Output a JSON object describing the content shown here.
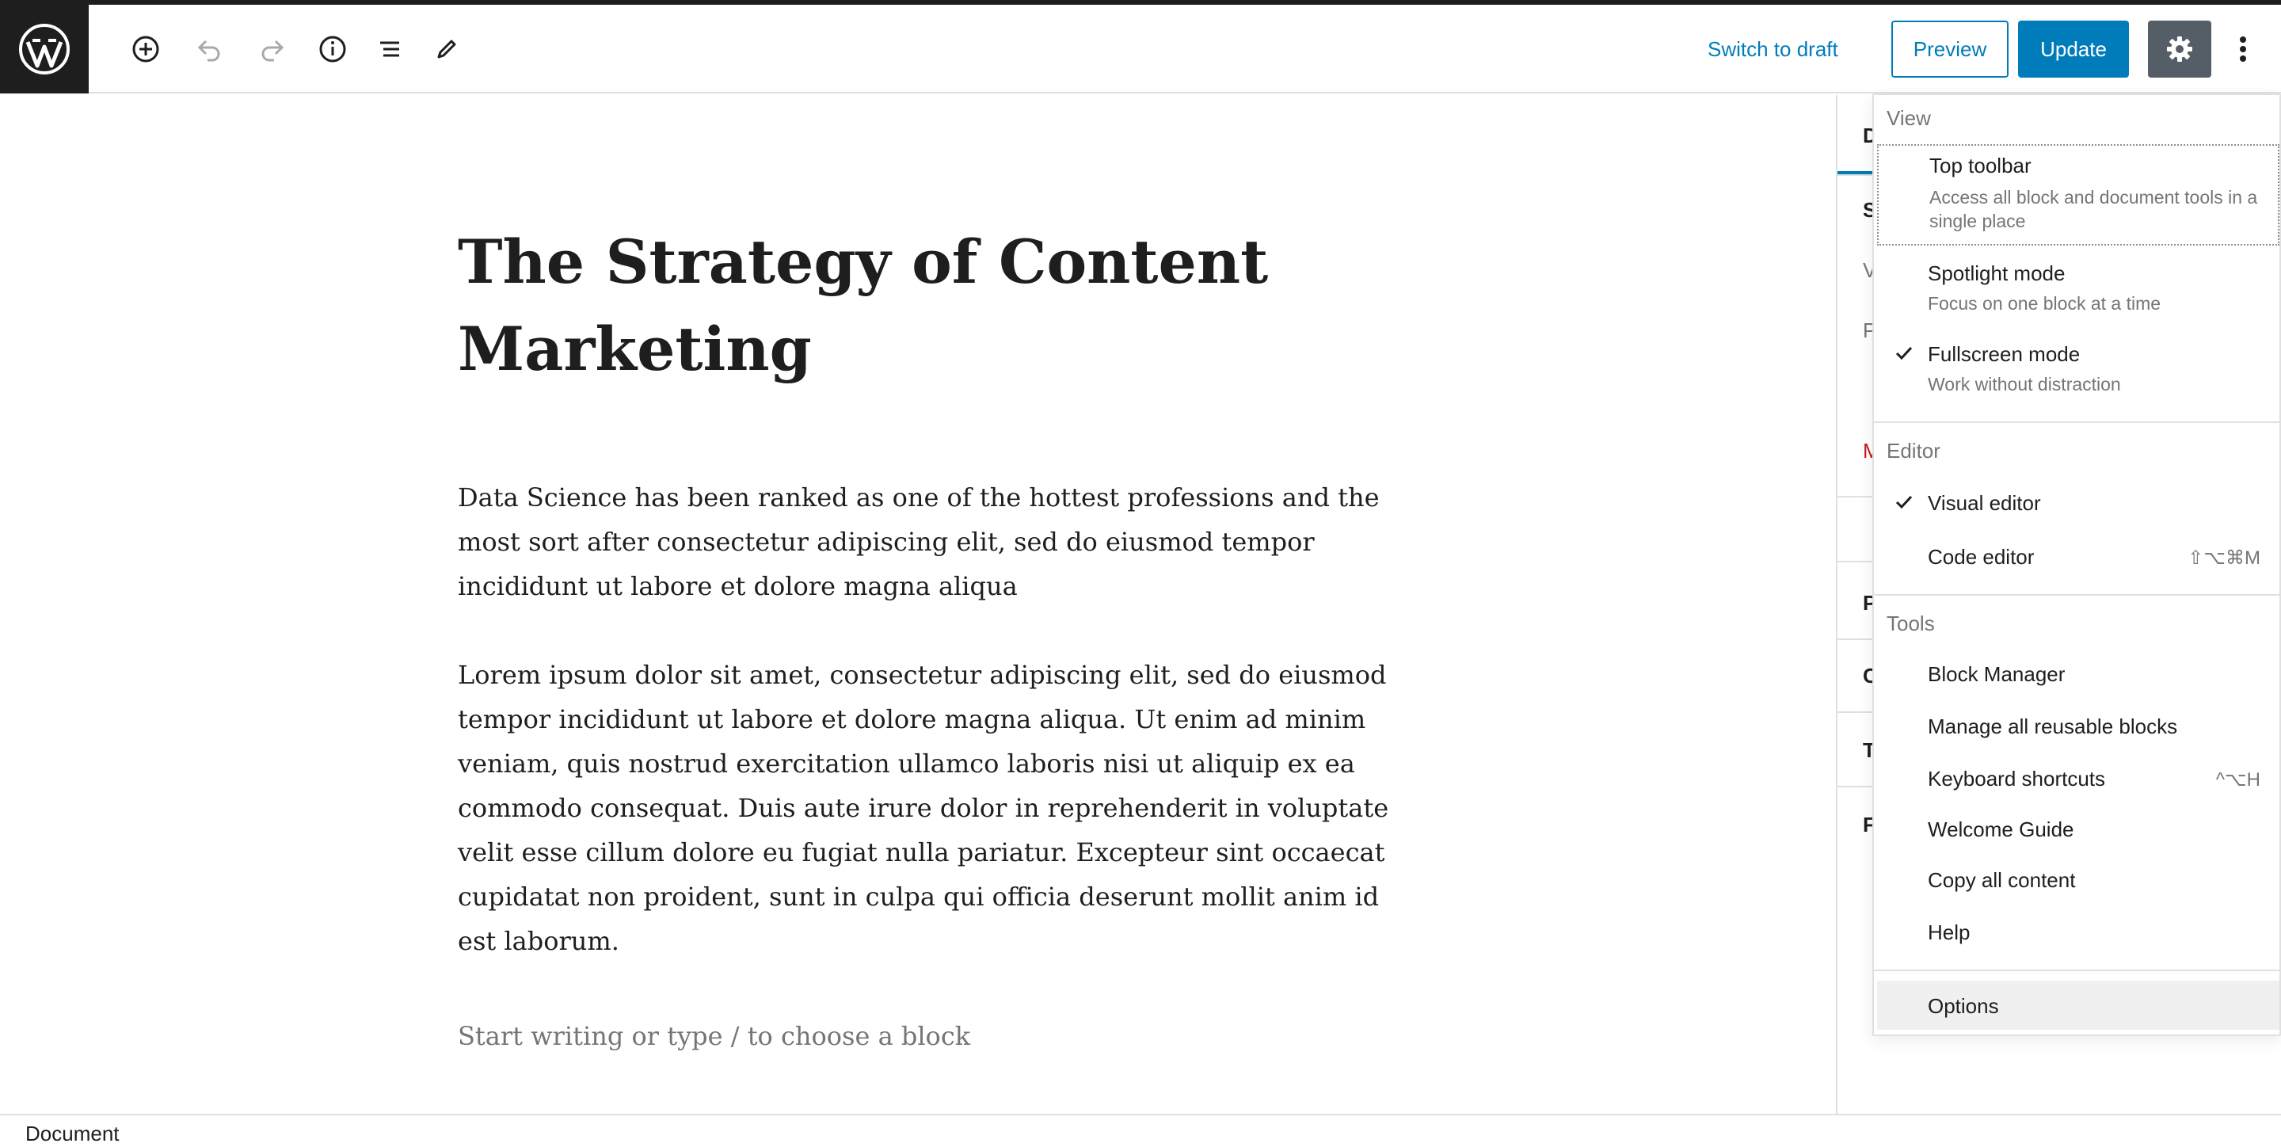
{
  "header": {
    "logo_icon": "wordpress-icon",
    "tools": [
      {
        "name": "add-block-icon"
      },
      {
        "name": "undo-icon"
      },
      {
        "name": "redo-icon"
      },
      {
        "name": "info-icon"
      },
      {
        "name": "list-view-icon"
      },
      {
        "name": "edit-mode-icon"
      }
    ],
    "switch_to_draft": "Switch to draft",
    "preview": "Preview",
    "update": "Update",
    "settings_icon": "gear-icon",
    "more_icon": "more-vertical-icon",
    "accent_color": "#007cba"
  },
  "post": {
    "title": "The Strategy of Content Marketing",
    "paragraphs": [
      "Data Science has been ranked as one of the hottest professions and the most sort after consectetur adipiscing elit, sed do eiusmod tempor incididunt ut labore et dolore magna aliqua",
      "Lorem ipsum dolor sit amet, consectetur adipiscing elit, sed do eiusmod tempor incididunt ut labore et dolore magna aliqua. Ut enim ad minim veniam, quis nostrud exercitation ullamco laboris nisi ut aliquip ex ea commodo consequat. Duis aute irure dolor in reprehenderit in voluptate velit esse cillum dolore eu fugiat nulla pariatur. Excepteur sint occaecat cupidatat non proident, sunt in culpa qui officia deserunt mollit anim id est laborum."
    ],
    "placeholder": "Start writing or type / to choose a block"
  },
  "sidebar": {
    "letters": [
      "D",
      "S",
      "V",
      "P",
      "M",
      "P",
      "C",
      "T",
      "F"
    ]
  },
  "menu": {
    "view": {
      "heading": "View",
      "items": [
        {
          "label": "Top toolbar",
          "desc": "Access all block and document tools in a single place",
          "checked": false
        },
        {
          "label": "Spotlight mode",
          "desc": "Focus on one block at a time",
          "checked": false
        },
        {
          "label": "Fullscreen mode",
          "desc": "Work without distraction",
          "checked": true
        }
      ]
    },
    "editor": {
      "heading": "Editor",
      "items": [
        {
          "label": "Visual editor",
          "checked": true,
          "shortcut": ""
        },
        {
          "label": "Code editor",
          "checked": false,
          "shortcut": "⇧⌥⌘M"
        }
      ]
    },
    "tools": {
      "heading": "Tools",
      "items": [
        {
          "label": "Block Manager",
          "shortcut": ""
        },
        {
          "label": "Manage all reusable blocks",
          "shortcut": ""
        },
        {
          "label": "Keyboard shortcuts",
          "shortcut": "^⌥H"
        },
        {
          "label": "Welcome Guide",
          "shortcut": ""
        },
        {
          "label": "Copy all content",
          "shortcut": ""
        },
        {
          "label": "Help",
          "shortcut": ""
        }
      ]
    },
    "options": {
      "label": "Options"
    }
  },
  "footer": {
    "breadcrumb": "Document"
  }
}
